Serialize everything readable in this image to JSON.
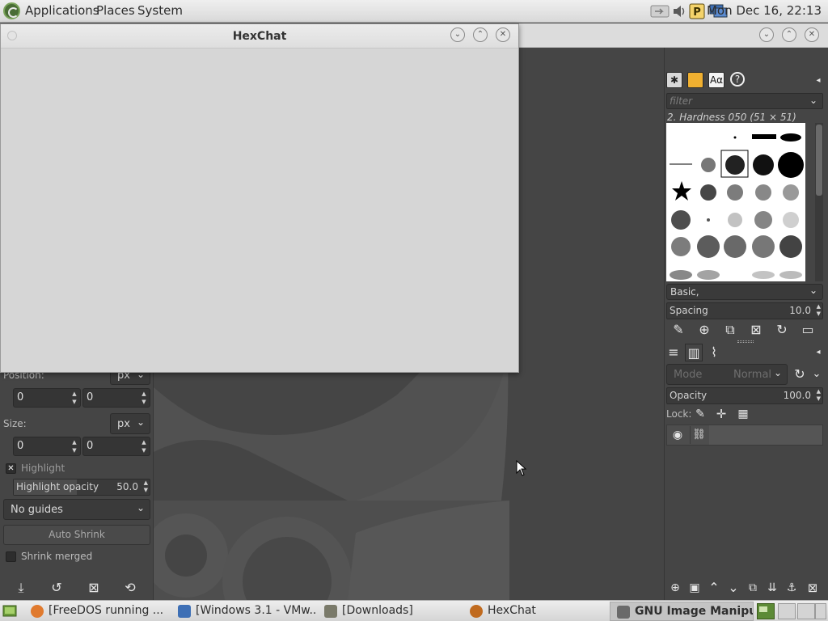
{
  "top_panel": {
    "menus": [
      "Applications",
      "Places",
      "System"
    ],
    "clock": "Mon Dec 16, 22:13"
  },
  "hexchat": {
    "title": "HexChat"
  },
  "left_dock": {
    "position_label": "Position:",
    "position_unit": "px",
    "position_x": "0",
    "position_y": "0",
    "size_label": "Size:",
    "size_unit": "px",
    "size_w": "0",
    "size_h": "0",
    "highlight_label": "Highlight",
    "highlight_opacity_label": "Highlight opacity",
    "highlight_opacity_value": "50.0",
    "guides_value": "No guides",
    "auto_shrink_label": "Auto Shrink",
    "shrink_merged_label": "Shrink merged"
  },
  "right_dock": {
    "filter_placeholder": "filter",
    "brush_name": "2. Hardness 050 (51 × 51)",
    "preset_value": "Basic,",
    "spacing_label": "Spacing",
    "spacing_value": "10.0",
    "mode_label": "Mode",
    "mode_value": "Normal",
    "opacity_label": "Opacity",
    "opacity_value": "100.0",
    "lock_label": "Lock:"
  },
  "taskbar": {
    "items": [
      {
        "label": "[FreeDOS running ...",
        "color": "#e07a2e"
      },
      {
        "label": "[Windows 3.1 - VMw...",
        "color": "#3d6fb5"
      },
      {
        "label": "[Downloads]",
        "color": "#7a7a6a"
      },
      {
        "label": "HexChat",
        "color": "#c06a1e"
      },
      {
        "label": "GNU Image Manipu...",
        "color": "#6a6a6a"
      }
    ]
  },
  "colors": {
    "gimp_bg": "#454545",
    "hexchat_bg": "#d6d6d6",
    "panel_bg": "#e0e0e0"
  }
}
